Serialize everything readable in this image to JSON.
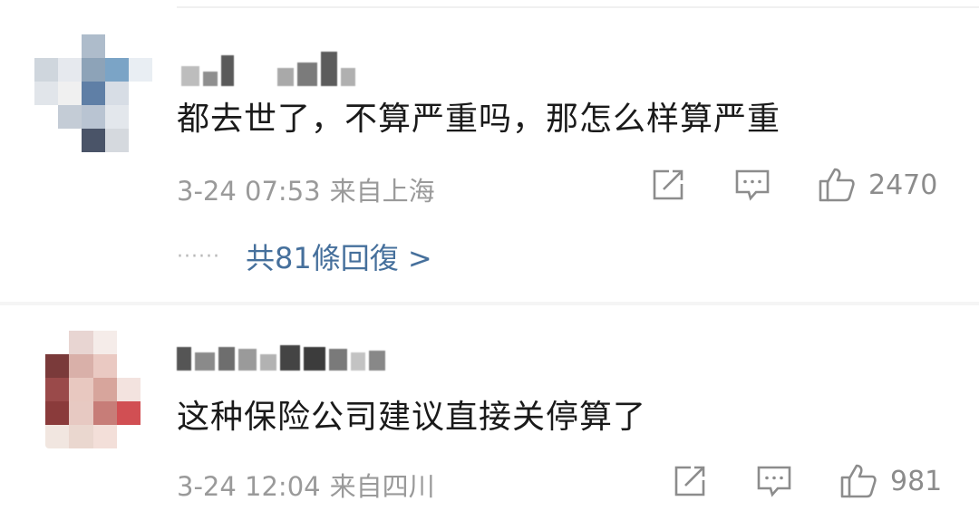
{
  "colors": {
    "text": "#1a1a1a",
    "meta": "#9a9a9a",
    "link": "#46709c"
  },
  "comments": [
    {
      "text": "都去世了，不算严重吗，那怎么样算严重",
      "time": "3-24 07:53",
      "location": "来自上海",
      "likes": "2470",
      "replies_label": "共81條回復 >",
      "dots": "······"
    },
    {
      "text": "这种保险公司建议直接关停算了",
      "time": "3-24 12:04",
      "location": "来自四川",
      "likes": "981"
    }
  ],
  "icons": [
    "share-icon",
    "comment-icon",
    "like-icon"
  ]
}
